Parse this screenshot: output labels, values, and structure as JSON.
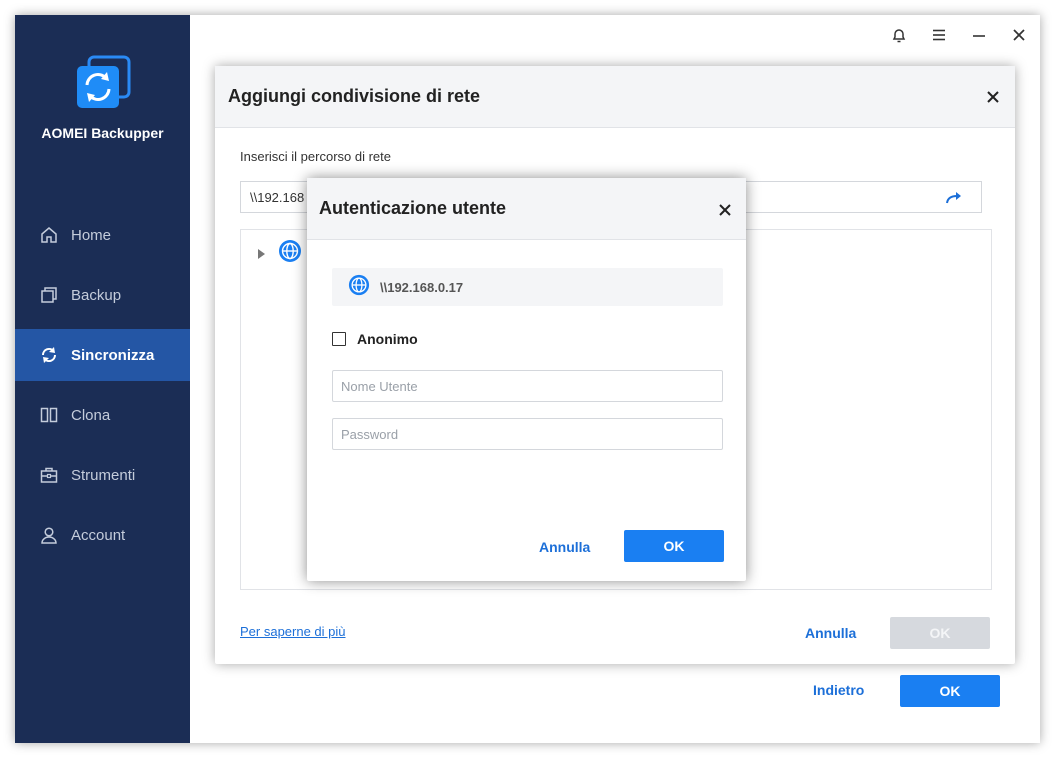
{
  "app": {
    "name": "AOMEI Backupper",
    "accent_color": "#1a7ff2",
    "sidebar_color": "#1b2d55",
    "active_color": "#2456a5"
  },
  "titlebar": {
    "icons": [
      "bell-icon",
      "menu-icon",
      "minimize-icon",
      "close-icon"
    ]
  },
  "sidebar": {
    "items": [
      {
        "label": "Home",
        "icon": "home-icon",
        "active": false
      },
      {
        "label": "Backup",
        "icon": "backup-icon",
        "active": false
      },
      {
        "label": "Sincronizza",
        "icon": "sync-icon",
        "active": true
      },
      {
        "label": "Clona",
        "icon": "clone-icon",
        "active": false
      },
      {
        "label": "Strumenti",
        "icon": "toolbox-icon",
        "active": false
      },
      {
        "label": "Account",
        "icon": "user-icon",
        "active": false
      }
    ]
  },
  "main_footer": {
    "back_label": "Indietro",
    "ok_label": "OK"
  },
  "network_dialog": {
    "title": "Aggiungi condivisione di rete",
    "path_label": "Inserisci il percorso di rete",
    "path_value": "\\\\192.168",
    "learn_more": "Per saperne di più",
    "cancel_label": "Annulla",
    "ok_label": "OK"
  },
  "auth_dialog": {
    "title": "Autenticazione utente",
    "host": "\\\\192.168.0.17",
    "anonymous_label": "Anonimo",
    "anonymous_checked": false,
    "username_placeholder": "Nome Utente",
    "password_placeholder": "Password",
    "cancel_label": "Annulla",
    "ok_label": "OK"
  }
}
